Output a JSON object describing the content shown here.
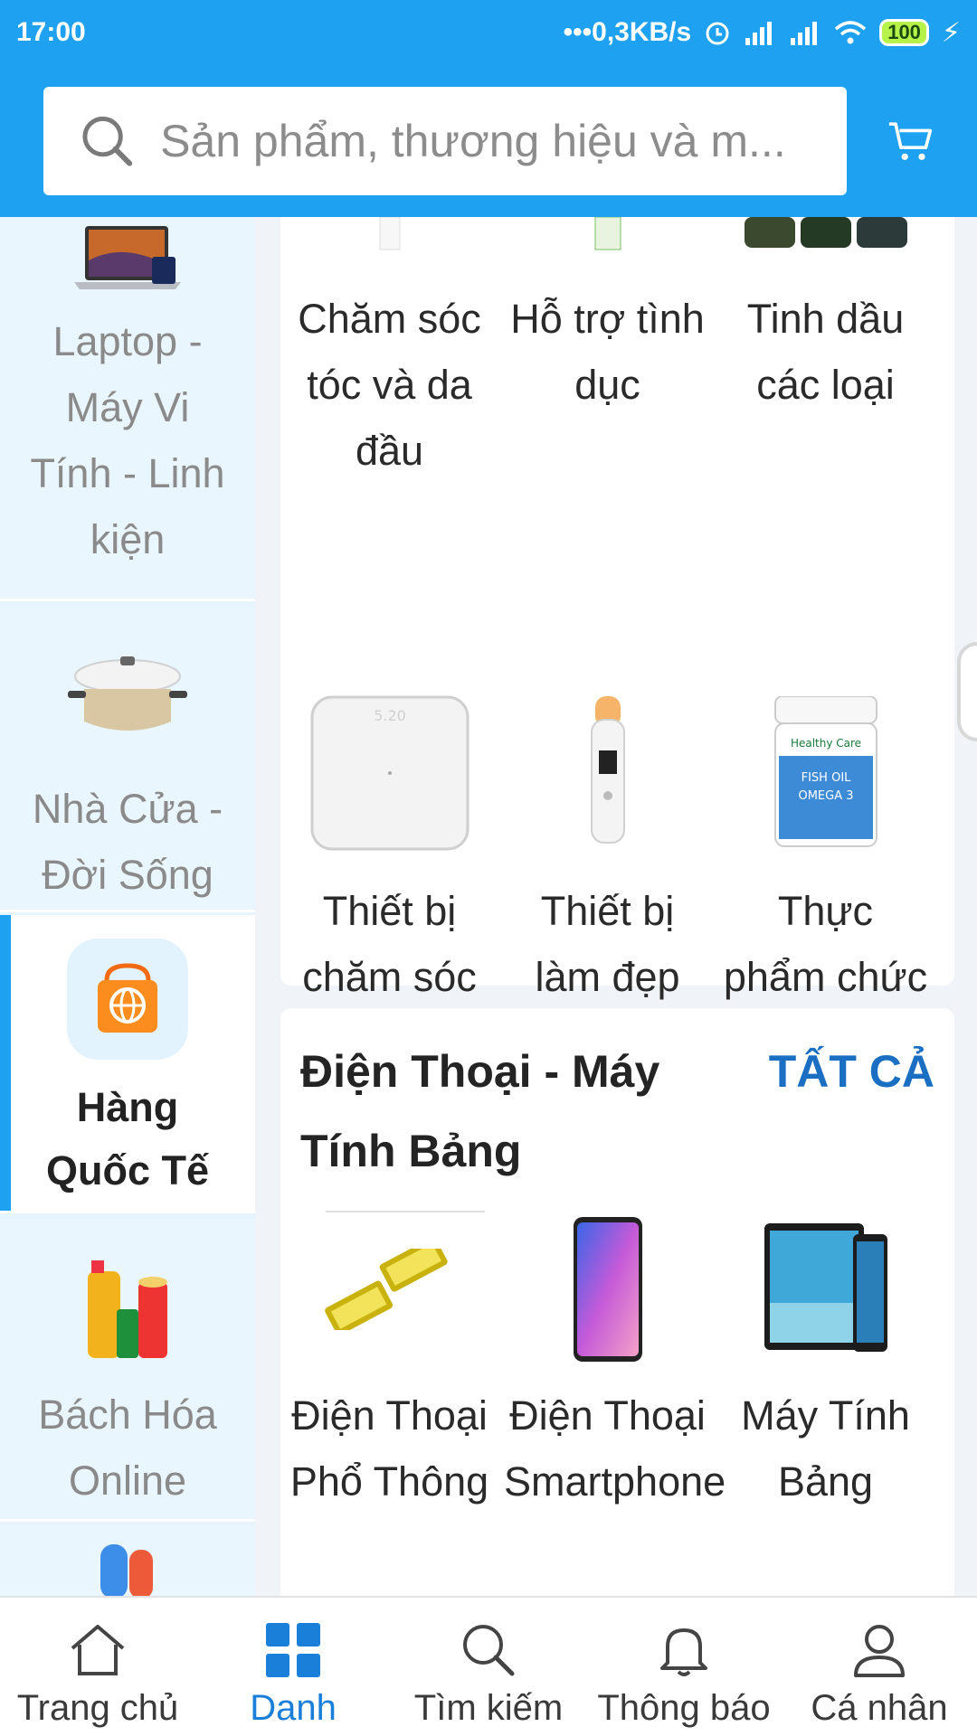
{
  "status_bar": {
    "time": "17:00",
    "network_speed": "0,3KB/s",
    "battery": "100"
  },
  "search": {
    "placeholder": "Sản phẩm, thương hiệu và m..."
  },
  "sidebar": {
    "items": [
      {
        "label": "Laptop - Máy Vi Tính - Linh kiện",
        "icon": "laptop-image"
      },
      {
        "label": "Nhà Cửa - Đời Sống",
        "icon": "cookware-image"
      },
      {
        "label": "Hàng Quốc Tế",
        "icon": "global-shopping-bag-icon",
        "active": true
      },
      {
        "label": "Bách Hóa Online",
        "icon": "grocery-image"
      }
    ]
  },
  "section_health": {
    "row1": [
      "Chăm sóc tóc và da đầu",
      "Hỗ trợ tình dục",
      "Tinh dầu các loại"
    ],
    "row2": [
      "Thiết bị chăm sóc sức khỏe",
      "Thiết bị làm đẹp",
      "Thực phẩm chức năng"
    ]
  },
  "section_phones": {
    "title": "Điện Thoại - Máy Tính Bảng",
    "see_all": "TẤT CẢ",
    "items": [
      "Điện Thoại Phổ Thông",
      "Điện Thoại Smartphone",
      "Máy Tính Bảng"
    ]
  },
  "bottom_nav": [
    {
      "label": "Trang chủ",
      "icon": "home-icon"
    },
    {
      "label": "Danh",
      "icon": "grid-icon",
      "active": true
    },
    {
      "label": "Tìm kiếm",
      "icon": "search-icon"
    },
    {
      "label": "Thông báo",
      "icon": "bell-icon"
    },
    {
      "label": "Cá nhân",
      "icon": "person-icon"
    }
  ],
  "colors": {
    "primary": "#1ea1f1",
    "see_all": "#1a6fc2",
    "sidebar_bg": "#e9f6fe"
  }
}
